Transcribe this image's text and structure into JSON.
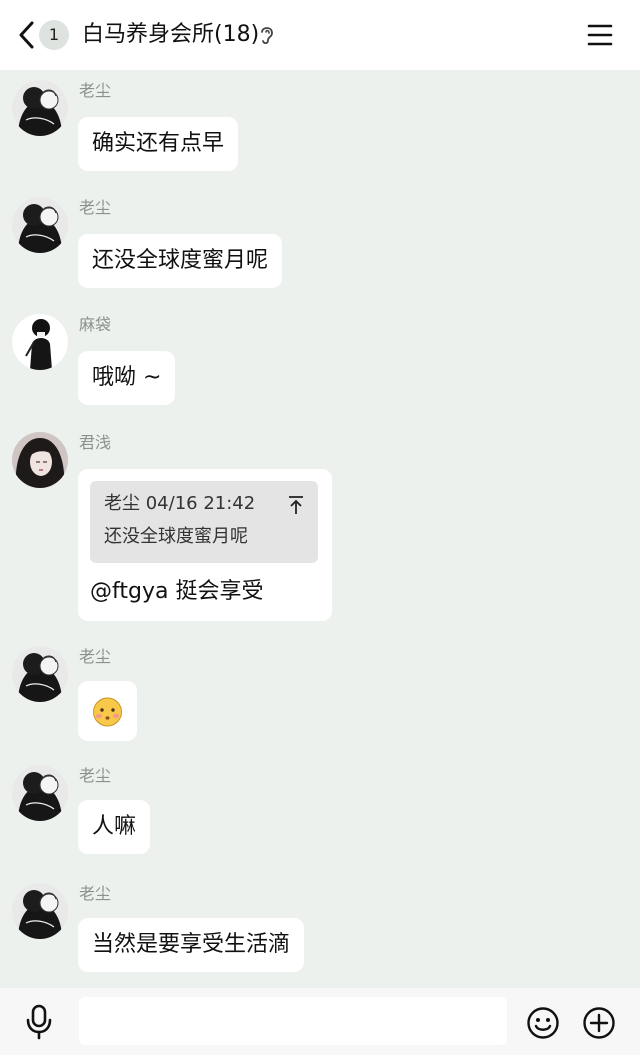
{
  "header": {
    "unread_count": "1",
    "title": "白马养身会所(18)"
  },
  "messages": [
    {
      "sender": "老尘",
      "avatar": "avatar-laochen",
      "text": "确实还有点早"
    },
    {
      "sender": "老尘",
      "avatar": "avatar-laochen",
      "text": "还没全球度蜜月呢"
    },
    {
      "sender": "麻袋",
      "avatar": "avatar-madai",
      "text": "哦呦 ~"
    },
    {
      "sender": "君浅",
      "avatar": "avatar-junqian",
      "quote": {
        "meta": "老尘 04/16 21:42",
        "text": "还没全球度蜜月呢"
      },
      "text": "@ftgya 挺会享受"
    },
    {
      "sender": "老尘",
      "avatar": "avatar-laochen",
      "sticker": "blushing-face-sticker"
    },
    {
      "sender": "老尘",
      "avatar": "avatar-laochen",
      "text": "人嘛"
    },
    {
      "sender": "老尘",
      "avatar": "avatar-laochen",
      "text": "当然是要享受生活滴"
    }
  ],
  "input": {
    "value": "",
    "placeholder": ""
  },
  "icons": {
    "back": "chevron-left-icon",
    "ear": "ear-icon",
    "menu": "hamburger-menu-icon",
    "mic": "microphone-icon",
    "emoji": "smiley-face-icon",
    "plus": "plus-circle-icon",
    "pin": "pin-top-icon"
  },
  "colors": {
    "chat_background": "#edf1ed",
    "bubble": "#ffffff",
    "sender_name": "#8d918d",
    "quote_background": "#e4e4e4"
  }
}
